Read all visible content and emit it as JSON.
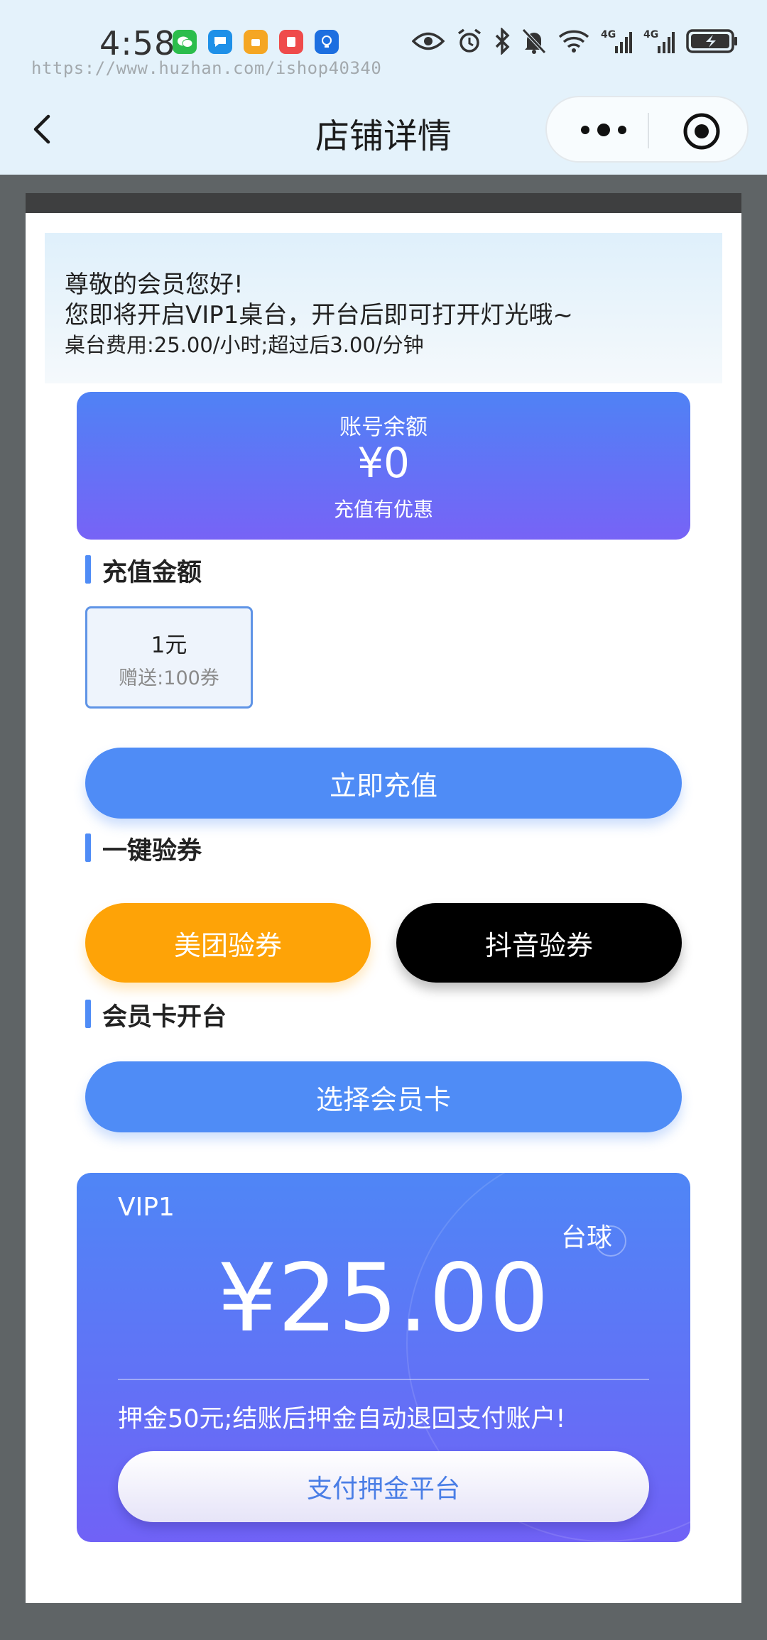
{
  "status_bar": {
    "time": "4:58",
    "watermark": "https://www.huzhan.com/ishop40340",
    "app_icons": [
      "wechat-icon",
      "message-icon",
      "orange-app-icon",
      "red-app-icon",
      "bulb-app-icon"
    ],
    "system_icons": [
      "eye-icon",
      "alarm-icon",
      "bluetooth-icon",
      "mute-icon",
      "wifi-icon",
      "signal-4g-icon",
      "signal-4g-icon",
      "battery-charging-icon"
    ]
  },
  "nav": {
    "title": "店铺详情"
  },
  "notice": {
    "greeting": "尊敬的会员您好!",
    "message": "您即将开启VIP1桌台，开台后即可打开灯光哦~",
    "fee": "桌台费用:25.00/小时;超过后3.00/分钟"
  },
  "balance": {
    "label": "账号余额",
    "amount": "¥0",
    "subtitle": "充值有优惠"
  },
  "recharge": {
    "section_title": "充值金额",
    "options": [
      {
        "amount": "1元",
        "gift": "赠送:100券",
        "selected": true
      }
    ],
    "button": "立即充值"
  },
  "coupon": {
    "section_title": "一键验券",
    "meituan_button": "美团验券",
    "douyin_button": "抖音验券"
  },
  "member_card": {
    "section_title": "会员卡开台",
    "button": "选择会员卡"
  },
  "table_card": {
    "name": "VIP1",
    "type": "台球",
    "price": "¥25.00",
    "deposit_note": "押金50元;结账后押金自动退回支付账户!",
    "pay_button": "支付押金平台"
  },
  "colors": {
    "primary": "#4f8cf6",
    "gradient_end": "#7763f6",
    "meituan": "#fea307",
    "douyin": "#000000",
    "topbar_bg": "#e4f2fb",
    "overlay": "#5f6466"
  }
}
